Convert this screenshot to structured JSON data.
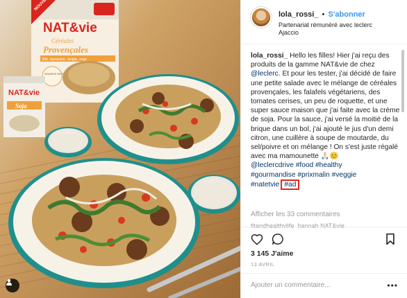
{
  "post": {
    "username": "lola_rossi_",
    "separator": "•",
    "follow_label": "S'abonner",
    "partnership": "Partenariat rémunéré avec leclerc",
    "location": "Ajaccio"
  },
  "photo": {
    "box_brand": "NAT&vie",
    "box_badge": "NOUVEAU",
    "box_title_1": "Céréales",
    "box_title_2": "Provençales",
    "box_subtitle": "Blé, épeautre, seigle, orge",
    "box_fibres": "SOURCE DE FIBRES",
    "brick_brand": "NAT&vie",
    "brick_product": "Soja"
  },
  "caption": {
    "user": "lola_rossi_",
    "text_1": " Hello les filles! Hier j'ai reçu des produits de la gamme NAT&vie de chez ",
    "mention": "@leclerc",
    "text_2": ". Et pour les tester, j'ai décidé de faire une petite salade avec le mélange de céréales provençales, les falafels végétariens, des tomates cerises, un peu de roquette, et une super sauce maison que j'ai faite avec la crème de soja. Pour la sauce, j'ai versé la moitié de la brique dans un bol, j'ai ajouté le jus d'un demi citron, une cuillère à soupe de moutarde, du sel/poivre et on mélange ! On s'est juste régalé avec ma mamounette ",
    "emoji": "🙏🏻😊",
    "tags_line_1": "@leclercdrive #food #healthy",
    "tags_line_2": "#gourmandise #prixmalin #veggie",
    "tags_line_3": "#natetvie",
    "ad_tag": "#ad"
  },
  "view_more": "Afficher les 33 commentaires",
  "next_comment_peek": "fitandhealthylife_hannah NAT&vie",
  "likes": "3 145 J'aime",
  "date": "13 AVRIL",
  "add_comment_placeholder": "Ajouter un commentaire...",
  "more_options": "•••",
  "colors": {
    "follow_blue": "#3897f0",
    "hashtag_blue": "#003569",
    "ad_highlight": "#e4261b",
    "box_red": "#d9251d",
    "box_orange": "#f0a03a",
    "plate_teal": "#1f8f8c"
  },
  "icons": {
    "like": "heart-icon",
    "comment": "comment-bubble-icon",
    "save": "bookmark-icon",
    "tag": "person-tag-icon"
  }
}
